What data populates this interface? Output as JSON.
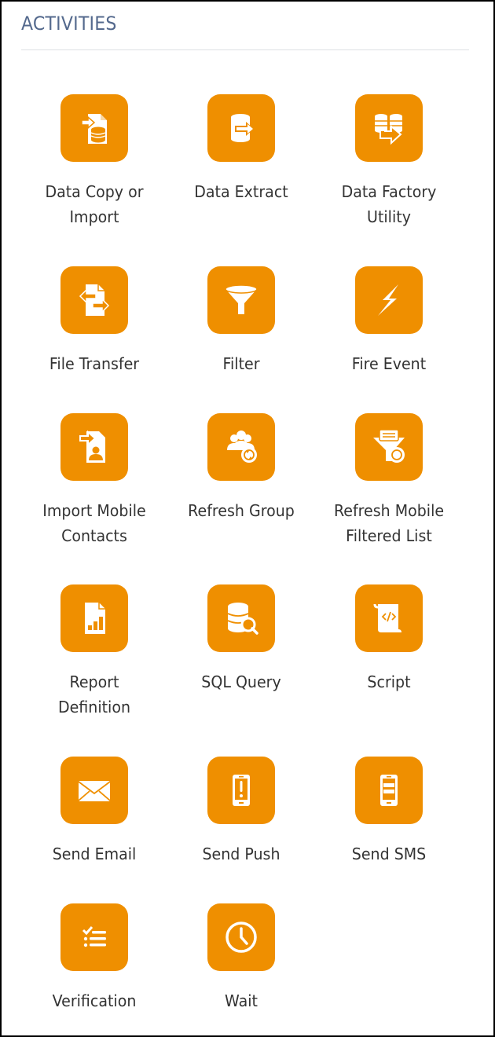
{
  "panel": {
    "title": "ACTIVITIES",
    "accent_color": "#ef8f00",
    "title_color": "#54698d"
  },
  "activities": [
    {
      "label_lines": [
        "Data Copy or",
        "Import"
      ],
      "icon": "data-copy-import-icon"
    },
    {
      "label_lines": [
        "Data Extract"
      ],
      "icon": "data-extract-icon"
    },
    {
      "label_lines": [
        "Data Factory",
        "Utility"
      ],
      "icon": "data-factory-utility-icon"
    },
    {
      "label_lines": [
        "File Transfer"
      ],
      "icon": "file-transfer-icon"
    },
    {
      "label_lines": [
        "Filter"
      ],
      "icon": "filter-icon"
    },
    {
      "label_lines": [
        "Fire Event"
      ],
      "icon": "fire-event-icon"
    },
    {
      "label_lines": [
        "Import Mobile",
        "Contacts"
      ],
      "icon": "import-mobile-contacts-icon"
    },
    {
      "label_lines": [
        "Refresh Group"
      ],
      "icon": "refresh-group-icon"
    },
    {
      "label_lines": [
        "Refresh Mobile",
        "Filtered List"
      ],
      "icon": "refresh-mobile-filtered-list-icon"
    },
    {
      "label_lines": [
        "Report",
        "Definition"
      ],
      "icon": "report-definition-icon"
    },
    {
      "label_lines": [
        "SQL Query"
      ],
      "icon": "sql-query-icon"
    },
    {
      "label_lines": [
        "Script"
      ],
      "icon": "script-icon"
    },
    {
      "label_lines": [
        "Send Email"
      ],
      "icon": "send-email-icon"
    },
    {
      "label_lines": [
        "Send Push"
      ],
      "icon": "send-push-icon"
    },
    {
      "label_lines": [
        "Send SMS"
      ],
      "icon": "send-sms-icon"
    },
    {
      "label_lines": [
        "Verification"
      ],
      "icon": "verification-icon"
    },
    {
      "label_lines": [
        "Wait"
      ],
      "icon": "wait-icon"
    }
  ]
}
